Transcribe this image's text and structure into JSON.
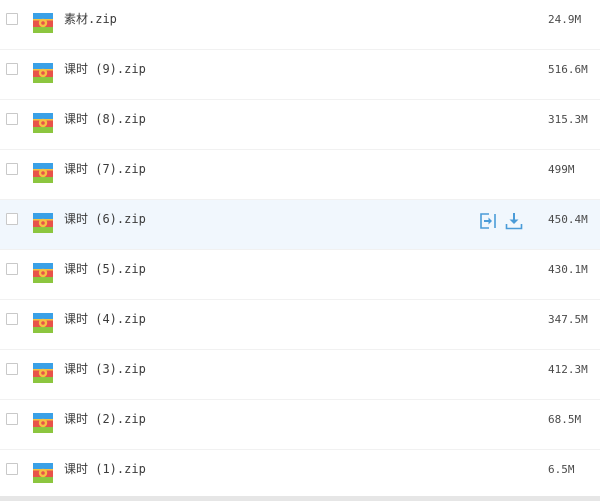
{
  "files": [
    {
      "name": "素材.zip",
      "size": "24.9M"
    },
    {
      "name": "课时 (9).zip",
      "size": "516.6M"
    },
    {
      "name": "课时 (8).zip",
      "size": "315.3M"
    },
    {
      "name": "课时 (7).zip",
      "size": "499M"
    },
    {
      "name": "课时 (6).zip",
      "size": "450.4M",
      "hovered": true
    },
    {
      "name": "课时 (5).zip",
      "size": "430.1M"
    },
    {
      "name": "课时 (4).zip",
      "size": "347.5M"
    },
    {
      "name": "课时 (3).zip",
      "size": "412.3M"
    },
    {
      "name": "课时 (2).zip",
      "size": "68.5M"
    },
    {
      "name": "课时 (1).zip",
      "size": "6.5M"
    }
  ],
  "icons": {
    "file": "zip-archive-icon",
    "share": "share-icon",
    "download": "download-icon"
  },
  "colors": {
    "hover_row": "#f1f7fd",
    "action_icon": "#4a9bd8"
  }
}
